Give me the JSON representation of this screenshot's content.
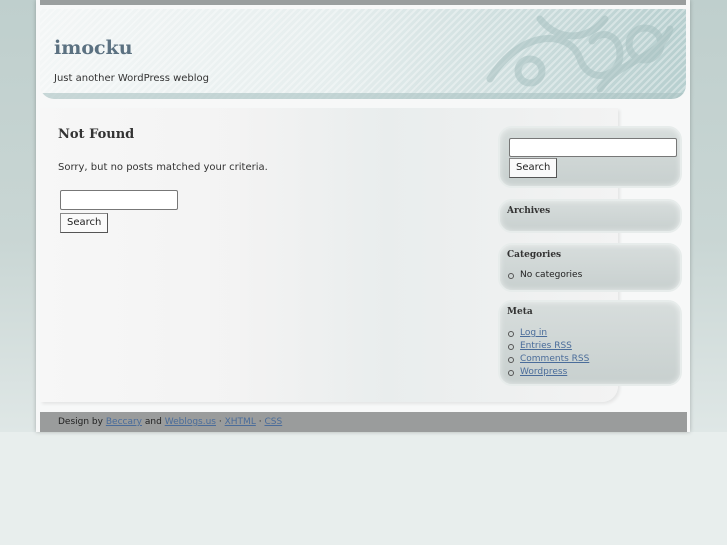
{
  "blog": {
    "title": "imocku",
    "tagline": "Just another WordPress weblog"
  },
  "main": {
    "heading": "Not Found",
    "message": "Sorry, but no posts matched your criteria.",
    "search_value": "",
    "search_button": "Search"
  },
  "sidebar": {
    "search_value": "",
    "search_button": "Search",
    "archives": {
      "title": "Archives"
    },
    "categories": {
      "title": "Categories",
      "items": [
        "No categories"
      ]
    },
    "meta": {
      "title": "Meta",
      "links": [
        "Log in",
        "Entries RSS",
        "Comments RSS",
        "Wordpress"
      ]
    }
  },
  "footer": {
    "prefix": "Design by",
    "link1": "Beccary",
    "and": "and",
    "link2": "Weblogs.us",
    "sep1": "·",
    "link3": "XHTML",
    "sep2": "·",
    "link4": "CSS"
  },
  "colors": {
    "title": "#5b7181",
    "link": "#4a6c9a",
    "footer_bar": "#9a9c9c",
    "page_background": "#e8eeed"
  }
}
